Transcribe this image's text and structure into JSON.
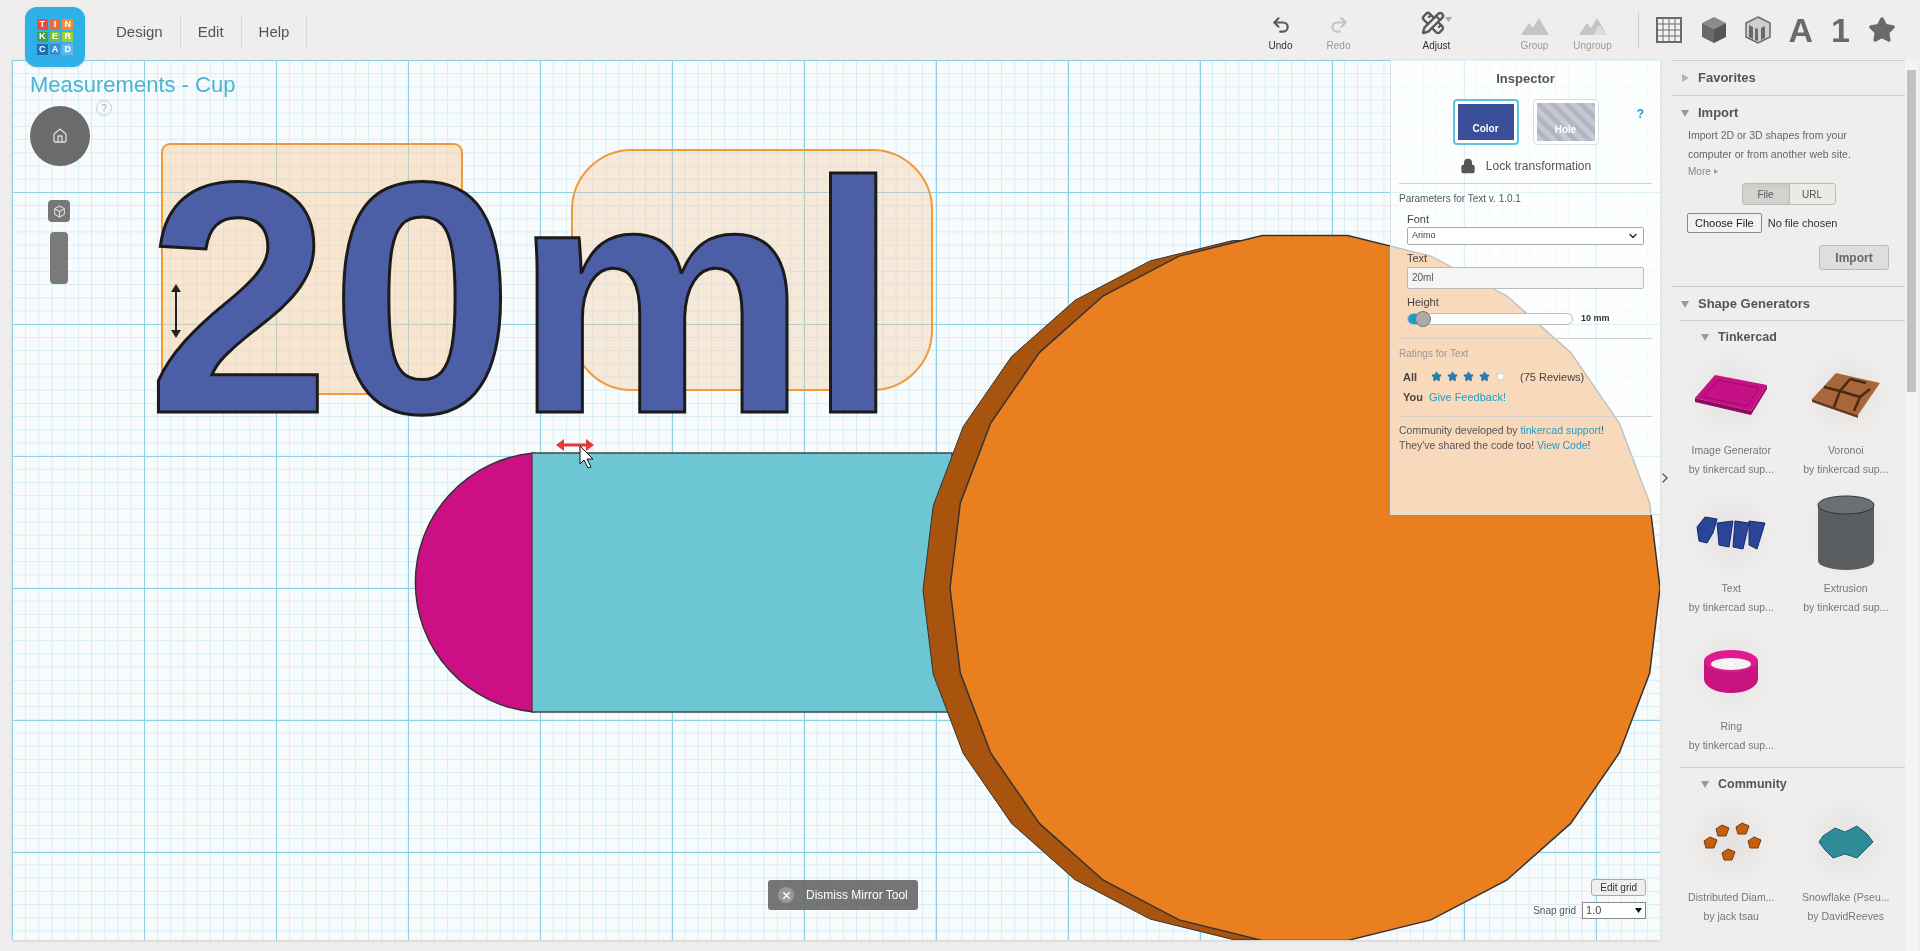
{
  "logo_letters": [
    "T",
    "I",
    "N",
    "K",
    "E",
    "R",
    "C",
    "A",
    "D"
  ],
  "menu": [
    {
      "label": "Design"
    },
    {
      "label": "Edit"
    },
    {
      "label": "Help"
    }
  ],
  "toolbar": [
    {
      "kind": "undo",
      "label": "Undo",
      "disabled": false
    },
    {
      "kind": "redo",
      "label": "Redo",
      "disabled": true
    },
    {
      "kind": "adjust",
      "label": "Adjust",
      "disabled": false
    },
    {
      "kind": "group",
      "label": "Group",
      "disabled": true
    },
    {
      "kind": "ungroup",
      "label": "Ungroup",
      "disabled": true
    }
  ],
  "view_tools": [
    {
      "kind": "grid"
    },
    {
      "kind": "box"
    },
    {
      "kind": "striped-box"
    },
    {
      "kind": "letter",
      "label": "A"
    },
    {
      "kind": "number",
      "label": "1"
    },
    {
      "kind": "star"
    }
  ],
  "design_title": "Measurements - Cup",
  "help_mark": "?",
  "scene": {
    "text_model": "20ml"
  },
  "inspector": {
    "title": "Inspector",
    "help": "?",
    "modes": [
      {
        "label": "Color",
        "selected": true
      },
      {
        "label": "Hole",
        "selected": false
      }
    ],
    "lock_label": "Lock transformation",
    "params_title": "Parameters for Text v. 1.0.1",
    "font": {
      "label": "Font",
      "value": "Arimo"
    },
    "text": {
      "label": "Text",
      "value": "20ml"
    },
    "height": {
      "label": "Height",
      "level": 0.04,
      "reading": "10 mm"
    },
    "ratings_title": "Ratings for Text",
    "all_label": "All",
    "stars": 4,
    "reviews": "(75 Reviews)",
    "you_label": "You",
    "feedback": "Give Feedback!",
    "community": {
      "before": "Community developed by ",
      "link": "tinkercad support",
      "after": "!"
    },
    "code": {
      "before": "They've shared the code too! ",
      "link": "View Code",
      "after": "!"
    }
  },
  "canvas_footer": {
    "dismiss": "Dismiss Mirror Tool",
    "edit_grid": "Edit grid",
    "snap_label": "Snap grid",
    "snap_value": "1.0"
  },
  "sidebar": {
    "favorites": {
      "title": "Favorites",
      "expanded": false
    },
    "import": {
      "title": "Import",
      "expanded": true,
      "description": "Import 2D or 3D shapes from your computer or from another web site.",
      "more": "More",
      "tabs": [
        {
          "label": "File",
          "selected": true
        },
        {
          "label": "URL",
          "selected": false
        }
      ],
      "choose_file": "Choose File",
      "no_file": "No file chosen",
      "button": "Import"
    },
    "shape_generators": {
      "title": "Shape Generators",
      "expanded": true,
      "groups": [
        {
          "title": "Tinkercad",
          "expanded": true,
          "items": [
            {
              "kind": "slab",
              "name": "Image Generator",
              "author": "by tinkercad sup..."
            },
            {
              "kind": "voronoi",
              "name": "Voronoi",
              "author": "by tinkercad sup..."
            },
            {
              "kind": "text3d",
              "name": "Text",
              "author": "by tinkercad sup..."
            },
            {
              "kind": "cylinder",
              "name": "Extrusion",
              "author": "by tinkercad sup..."
            },
            {
              "kind": "ring",
              "name": "Ring",
              "author": "by tinkercad sup..."
            }
          ]
        },
        {
          "title": "Community",
          "expanded": true,
          "items": [
            {
              "kind": "scatter",
              "name": "Distributed Diam...",
              "author": "by jack tsau"
            },
            {
              "kind": "snowflake",
              "name": "Snowflake (Pseu...",
              "author": "by DavidReeves"
            }
          ]
        }
      ]
    }
  }
}
